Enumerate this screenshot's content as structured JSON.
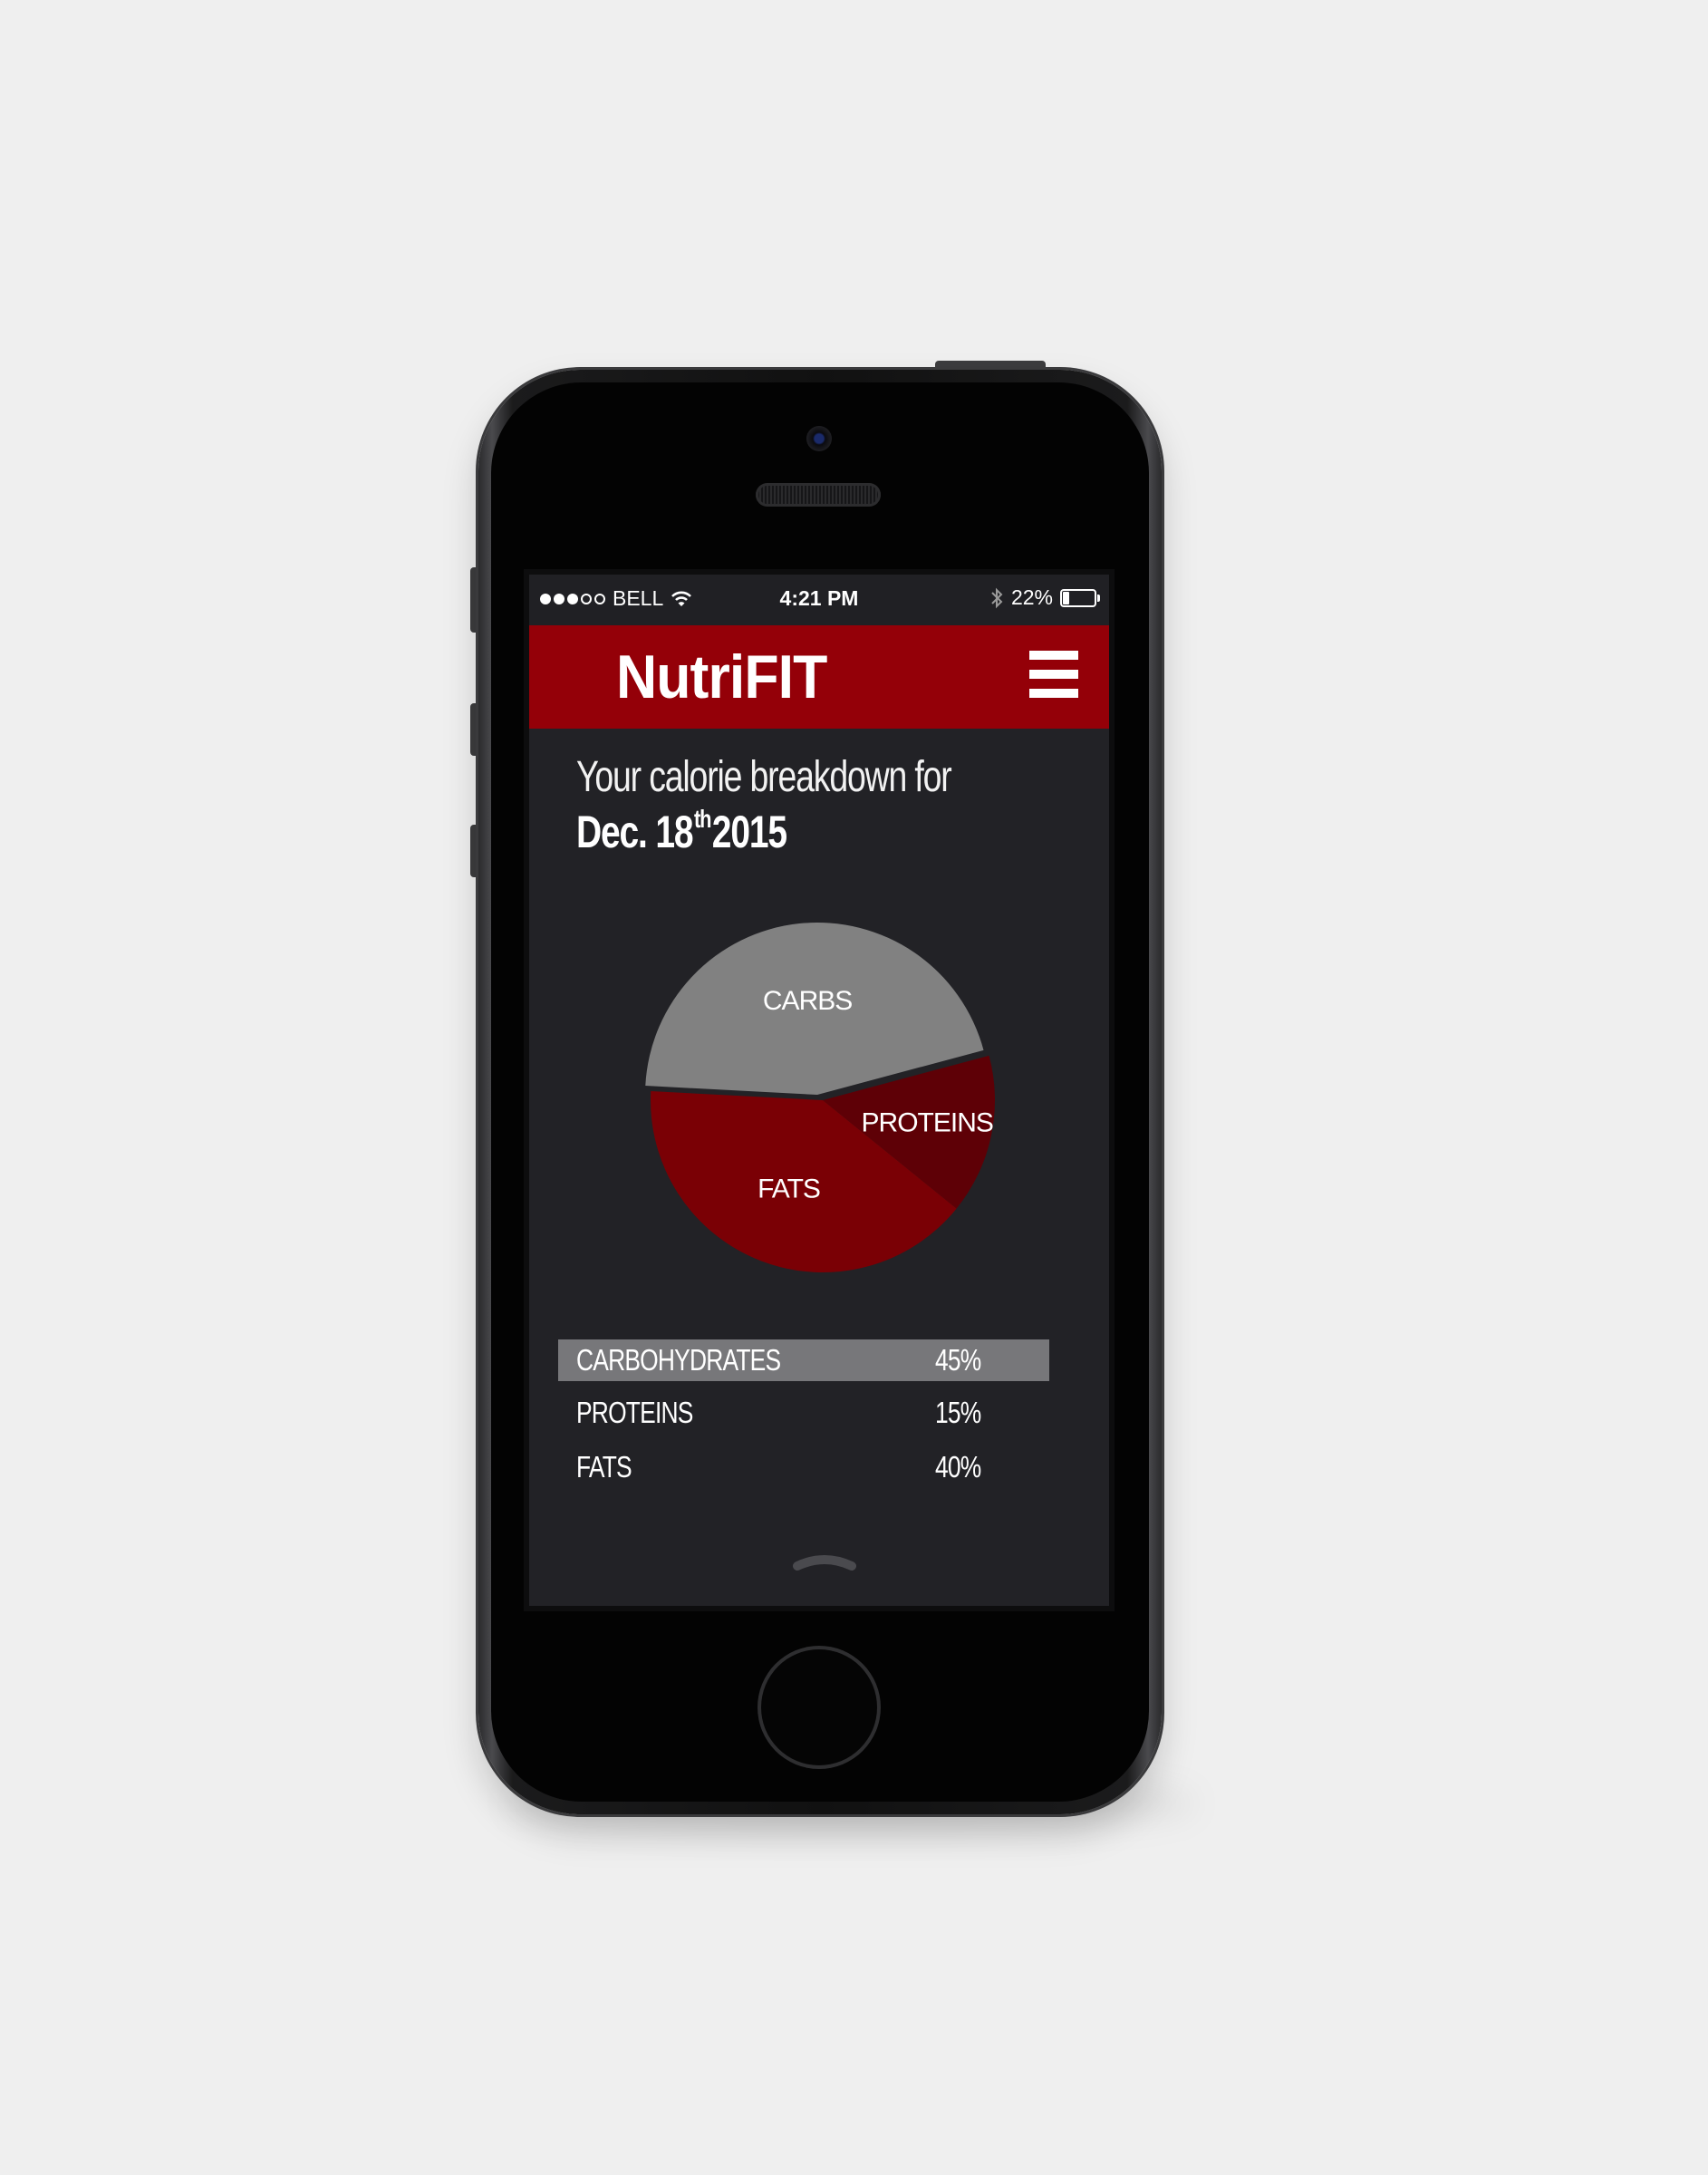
{
  "status_bar": {
    "signal_filled": 3,
    "signal_total": 5,
    "carrier": "BELL",
    "time": "4:21 PM",
    "battery_text": "22%",
    "battery_level": 0.22
  },
  "header": {
    "title": "NutriFIT",
    "menu_icon": "hamburger-menu-icon"
  },
  "heading": {
    "line1": "Your calorie breakdown for",
    "date_prefix": "Dec. 18",
    "date_suffix": "th",
    "date_year": "2015"
  },
  "chart_data": {
    "type": "pie",
    "slices": [
      {
        "label": "CARBS",
        "value": 45,
        "color": "#818181"
      },
      {
        "label": "PROTEINS",
        "value": 15,
        "color": "#5e0006"
      },
      {
        "label": "FATS",
        "value": 40,
        "color": "#7a0005"
      }
    ]
  },
  "breakdown": [
    {
      "label": "CARBOHYDRATES",
      "value": "45%",
      "selected": true
    },
    {
      "label": "PROTEINS",
      "value": "15%",
      "selected": false
    },
    {
      "label": "FATS",
      "value": "40%",
      "selected": false
    }
  ],
  "colors": {
    "brand": "#940008",
    "background": "#222226",
    "selected_row": "#77777a"
  },
  "icons": {
    "pull_up": "chevron-up-icon"
  }
}
